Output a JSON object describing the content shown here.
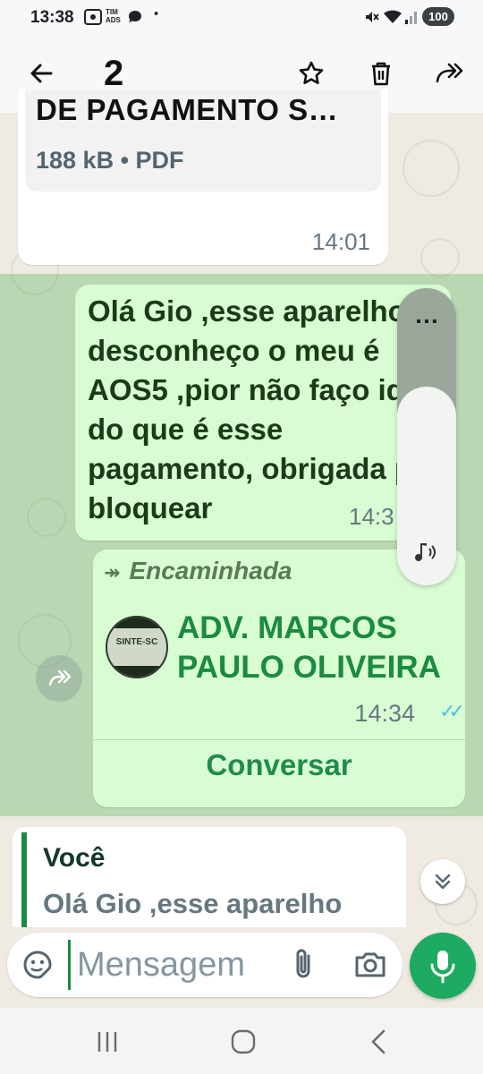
{
  "status_bar": {
    "time": "13:38",
    "carrier_label": "TIM ADS",
    "battery": "100",
    "icons": [
      "screenshot-icon",
      "carrier-icon",
      "chat-bubble-icon",
      "dot-icon",
      "mute-icon",
      "wifi-icon",
      "signal-icon",
      "battery-icon"
    ]
  },
  "app_bar": {
    "selected_count": "2",
    "actions": [
      "back-arrow-icon",
      "star-icon",
      "trash-icon",
      "forward-icon"
    ]
  },
  "messages": {
    "pdf": {
      "title": "DE PAGAMENTO S…",
      "meta": "188 kB • PDF",
      "time": "14:01"
    },
    "text": {
      "body": "Olá Gio ,esse aparelho desconheço o meu é AOS5 ,pior não faço ideia do que é esse pagamento, obrigada por bloquear",
      "time": "14:3"
    },
    "contact": {
      "forwarded_label": "Encaminhada",
      "avatar_text": "SINTE-SC",
      "name": "ADV. MARCOS PAULO OLIVEIRA",
      "time": "14:34",
      "action_label": "Conversar"
    }
  },
  "volume_panel": {
    "level_fraction": 0.67,
    "more_label": "…"
  },
  "reply_preview": {
    "sender": "Você",
    "text": "Olá Gio ,esse aparelho"
  },
  "composer": {
    "placeholder": "Mensagem"
  },
  "colors": {
    "accent_green": "#1daa61",
    "outgoing_bubble": "#d9fdd3",
    "selection_overlay": "#4caf50",
    "read_ticks": "#53bdeb",
    "chat_background": "#efeae2"
  }
}
